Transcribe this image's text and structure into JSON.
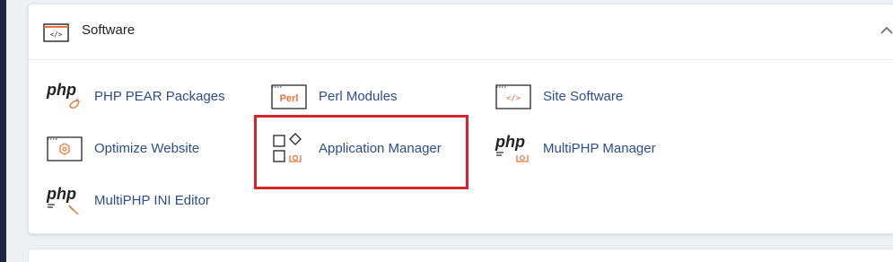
{
  "section": {
    "title": "Software",
    "header_icon": "code-window-icon",
    "collapse_icon": "chevron-up-icon"
  },
  "items": [
    {
      "label": "PHP PEAR Packages",
      "icon": "php-pear-icon",
      "icon_text": "php"
    },
    {
      "label": "Perl Modules",
      "icon": "perl-icon",
      "icon_text": "Perl"
    },
    {
      "label": "Site Software",
      "icon": "code-window-icon"
    },
    {
      "label": "Optimize Website",
      "icon": "optimize-gear-icon"
    },
    {
      "label": "Application Manager",
      "icon": "application-manager-icon"
    },
    {
      "label": "MultiPHP Manager",
      "icon": "php-manager-icon",
      "icon_text": "php"
    },
    {
      "label": "MultiPHP INI Editor",
      "icon": "php-ini-editor-icon",
      "icon_text": "php"
    }
  ],
  "colors": {
    "link": "#2d4e8c",
    "accent_orange": "#e8743b",
    "highlight_red": "#d9232a",
    "sidebar_dark": "#1e2540"
  }
}
